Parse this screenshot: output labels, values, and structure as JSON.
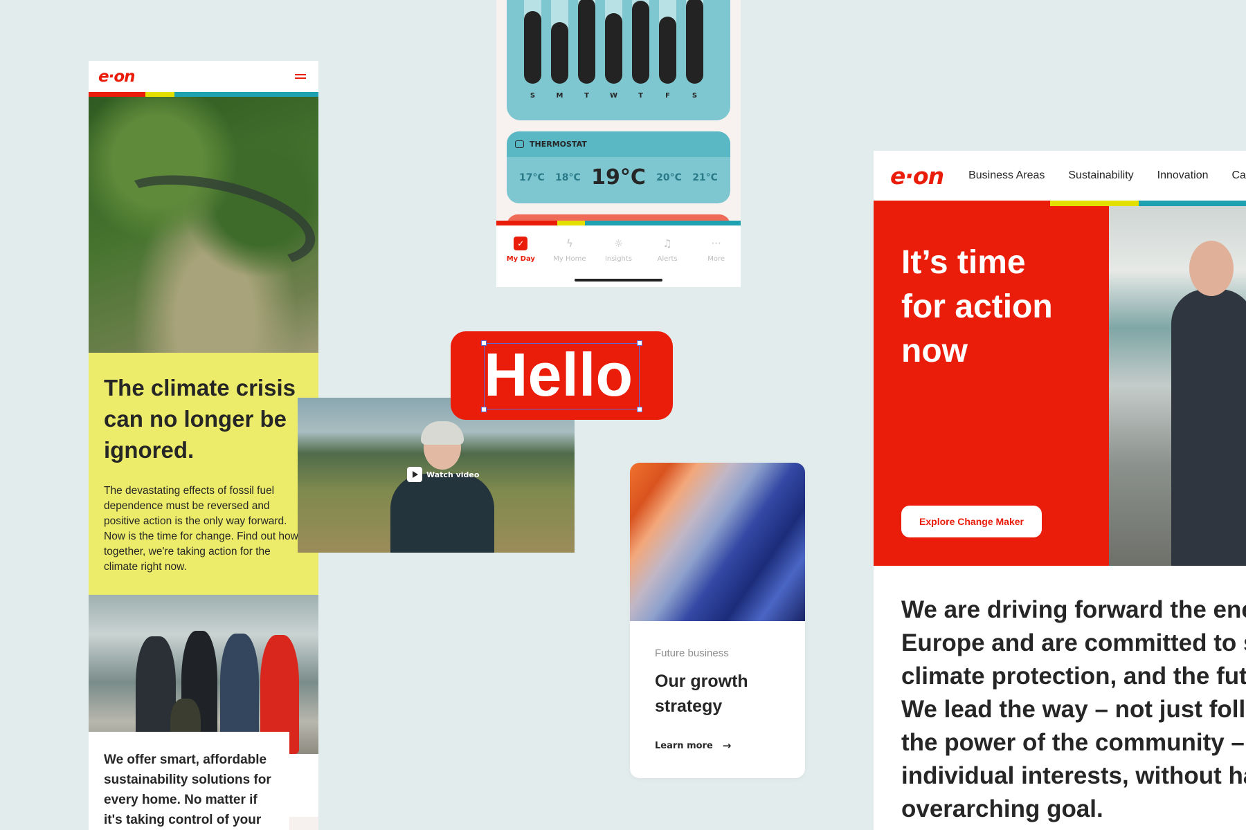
{
  "mobile": {
    "logo": "e·on",
    "headline": "The climate crisis can no longer be ignored.",
    "body": "The devastating effects of fossil fuel dependence must be reversed and positive action is the only way forward. Now is the time for change. Find out how, together, we're taking action for the climate right now.",
    "bottom_text": "We offer smart, affordable sustainability solutions for every home. No matter if it's taking control of your"
  },
  "video": {
    "watch_label": "Watch video"
  },
  "hello": {
    "text": "Hello"
  },
  "app": {
    "days": [
      "S",
      "M",
      "T",
      "W",
      "T",
      "F",
      "S"
    ],
    "usage_levels": [
      0.85,
      0.72,
      1.0,
      0.82,
      0.97,
      0.78,
      1.0
    ],
    "thermostat_label": "THERMOSTAT",
    "temps": [
      "17°C",
      "18°C",
      "19°C",
      "20°C",
      "21°C"
    ],
    "active_temp": "19°C",
    "tabs": [
      {
        "label": "My Day",
        "icon": "check-icon",
        "active": true
      },
      {
        "label": "My Home",
        "icon": "bolt-icon",
        "active": false
      },
      {
        "label": "Insights",
        "icon": "sun-icon",
        "active": false
      },
      {
        "label": "Alerts",
        "icon": "bell-icon",
        "active": false
      },
      {
        "label": "More",
        "icon": "more-icon",
        "active": false
      }
    ]
  },
  "growth": {
    "kicker": "Future business",
    "title": "Our growth strategy",
    "link": "Learn more"
  },
  "desktop": {
    "logo": "e·on",
    "nav": [
      "Business Areas",
      "Sustainability",
      "Innovation",
      "Care"
    ],
    "hero_title": [
      "It’s time",
      "for action",
      "now"
    ],
    "cta": "Explore Change Maker",
    "body_lines": [
      "We are driving forward the ene",
      "Europe and are committed to s",
      "climate protection, and the futu",
      "We lead the way – not just follo",
      "the power of the community –",
      "individual interests, without ha",
      "overarching goal."
    ]
  },
  "colors": {
    "red": "#ea1c0a",
    "yellow": "#e3e000",
    "teal": "#1ea2b1",
    "highlight_yellow": "#ecec6a",
    "app_teal": "#7ec7d1"
  }
}
